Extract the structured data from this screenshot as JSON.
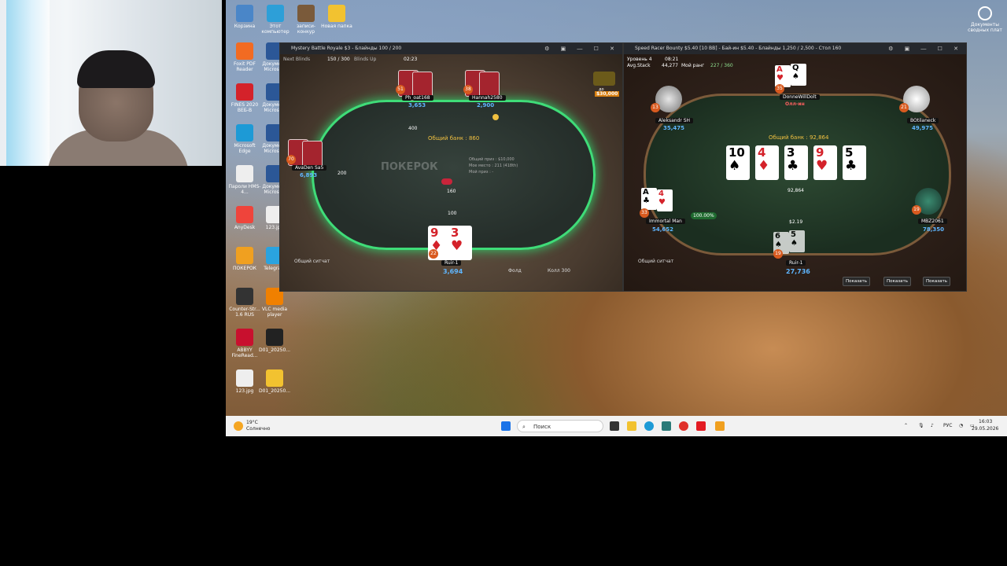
{
  "desktop": {
    "icons": [
      {
        "label": "Корзина",
        "icon": "recycle-bin-icon",
        "color": "#4a86c8"
      },
      {
        "label": "Этот компьютер",
        "icon": "computer-icon",
        "color": "#2d9fd8"
      },
      {
        "label": "записи-конкур",
        "icon": "image-file-icon",
        "color": "#7a5a3a"
      },
      {
        "label": "Новая папка",
        "icon": "folder-icon",
        "color": "#f2c230"
      },
      {
        "label": "Foxit PDF Reader",
        "icon": "pdf-icon",
        "color": "#f26b22"
      },
      {
        "label": "Документ Microsoft",
        "icon": "word-icon",
        "color": "#2b5797"
      },
      {
        "label": "FINES 2020 ВЕБ-В",
        "icon": "app-icon",
        "color": "#d4222a"
      },
      {
        "label": "Документ Microsoft",
        "icon": "word-icon",
        "color": "#2b5797"
      },
      {
        "label": "Microsoft Edge",
        "icon": "edge-icon",
        "color": "#1d9ad6"
      },
      {
        "label": "Документ Microsoft",
        "icon": "word-icon",
        "color": "#2b5797"
      },
      {
        "label": "Пароли HMS-4...",
        "icon": "text-file-icon",
        "color": "#eeeeee"
      },
      {
        "label": "Документ Microsoft",
        "icon": "word-icon",
        "color": "#2b5797"
      },
      {
        "label": "AnyDesk",
        "icon": "anydesk-icon",
        "color": "#ef443b"
      },
      {
        "label": "123.jpg",
        "icon": "image-file-icon",
        "color": "#eeeeee"
      },
      {
        "label": "ПОКЕРОК",
        "icon": "pokerok-icon",
        "color": "#f0a020"
      },
      {
        "label": "Telegram",
        "icon": "telegram-icon",
        "color": "#2aa3df"
      },
      {
        "label": "Counter-Str... 1.6 RUS",
        "icon": "cs-icon",
        "color": "#333333"
      },
      {
        "label": "VLC media player",
        "icon": "vlc-icon",
        "color": "#f08000"
      },
      {
        "label": "ABBYY FineRead...",
        "icon": "abbyy-icon",
        "color": "#c8102e"
      },
      {
        "label": "D01_20250...",
        "icon": "video-file-icon",
        "color": "#222222"
      },
      {
        "label": "123.jpg",
        "icon": "image-file-icon",
        "color": "#eeeeee"
      },
      {
        "label": "D01_20250...",
        "icon": "folder-icon",
        "color": "#f2c230"
      }
    ],
    "top_right_label": "Документы сводных плат"
  },
  "table1": {
    "title": "Mystery Battle Royale $3 - Блайнды 100 / 200",
    "next_blinds_label": "Next Blinds",
    "next_blinds": "150 / 300",
    "blinds_up_label": "Blinds Up",
    "timer": "02:23",
    "bounty_label": "до",
    "bounty": "$30,000",
    "total_pot": "Общий банк : 860",
    "watermark": "ПОКЕРОК",
    "info_total_prize": "Общий приз : $10,000",
    "info_my_place": "Мое место : 211 (418th)",
    "info_my_prize": "Мой приз : -",
    "players": [
      {
        "name": "Ph_oat168",
        "stack": "3,653",
        "level": "51",
        "bet": "400"
      },
      {
        "name": "Hannah2580",
        "stack": "2,900",
        "level": "38",
        "bet": ""
      },
      {
        "name": "AvaDen Sa5",
        "stack": "6,893",
        "level": "70",
        "bet": "200"
      },
      {
        "name": "Ruir-1",
        "stack": "3,694",
        "level": "22",
        "bet": "100"
      }
    ],
    "hero_cards": [
      {
        "rank": "9",
        "suit": "♦",
        "color": "red"
      },
      {
        "rank": "3",
        "suit": "♥",
        "color": "red"
      }
    ],
    "pot_chips": "160",
    "chat_label": "Общий ситчат",
    "fold_label": "Фолд",
    "call_label": "Колл 300"
  },
  "table2": {
    "title": "Speed Racer Bounty $5.40 [10 BB] - Бай-ин $5.40 - Блайнды 1,250 / 2,500 - Стол 160",
    "level_label": "Уровень 4",
    "level_timer": "08:21",
    "avg_stack_label": "Avg.Stack",
    "avg_stack": "44,277",
    "my_rank_label": "Мой ранг",
    "my_rank": "227 / 360",
    "total_pot": "Общий банк : 92,864",
    "center_pot": "92,864",
    "board": [
      {
        "rank": "10",
        "suit": "♠",
        "color": "black"
      },
      {
        "rank": "4",
        "suit": "♦",
        "color": "red"
      },
      {
        "rank": "3",
        "suit": "♣",
        "color": "black"
      },
      {
        "rank": "9",
        "suit": "♥",
        "color": "red"
      },
      {
        "rank": "5",
        "suit": "♣",
        "color": "black"
      }
    ],
    "players": [
      {
        "name": "DonneWillDolt",
        "stack": "Олл-ин",
        "level": "35",
        "bounty": "$1.75"
      },
      {
        "name": "Aleksandr SH",
        "stack": "35,475",
        "level": "13",
        "bounty": "$2.50"
      },
      {
        "name": "BOtilaneck",
        "stack": "49,975",
        "level": "21",
        "bounty": "$2.51"
      },
      {
        "name": "Immortal Man",
        "stack": "54,652",
        "level": "33",
        "bounty": "$4.69"
      },
      {
        "name": "MBZ2061",
        "stack": "78,350",
        "level": "19",
        "bounty": "$2.56"
      },
      {
        "name": "Ruir-1",
        "stack": "27,736",
        "level": "19",
        "bounty": "$2.19"
      }
    ],
    "donne_cards": [
      {
        "rank": "A",
        "suit": "♥",
        "color": "red"
      },
      {
        "rank": "Q",
        "suit": "♠",
        "color": "black"
      }
    ],
    "immortal_cards": [
      {
        "rank": "A",
        "suit": "♣",
        "color": "black"
      },
      {
        "rank": "4",
        "suit": "♥",
        "color": "red"
      }
    ],
    "hero_cards": [
      {
        "rank": "6",
        "suit": "♠",
        "color": "black"
      },
      {
        "rank": "5",
        "suit": "♠",
        "color": "black"
      }
    ],
    "equity": "100.00%",
    "chat_label": "Общий ситчат",
    "show_buttons": [
      "Показать",
      "Показать",
      "Показать"
    ]
  },
  "taskbar": {
    "weather_temp": "19°C",
    "weather_desc": "Солнечно",
    "search_placeholder": "Поиск",
    "lang": "РУС",
    "time": "16:03",
    "date": "29.05.2026"
  },
  "colors": {
    "felt_glow": "#3fdc78",
    "stack_blue": "#5fb6ff",
    "pot_gold": "#f0c040",
    "card_back": "#a4242e"
  }
}
